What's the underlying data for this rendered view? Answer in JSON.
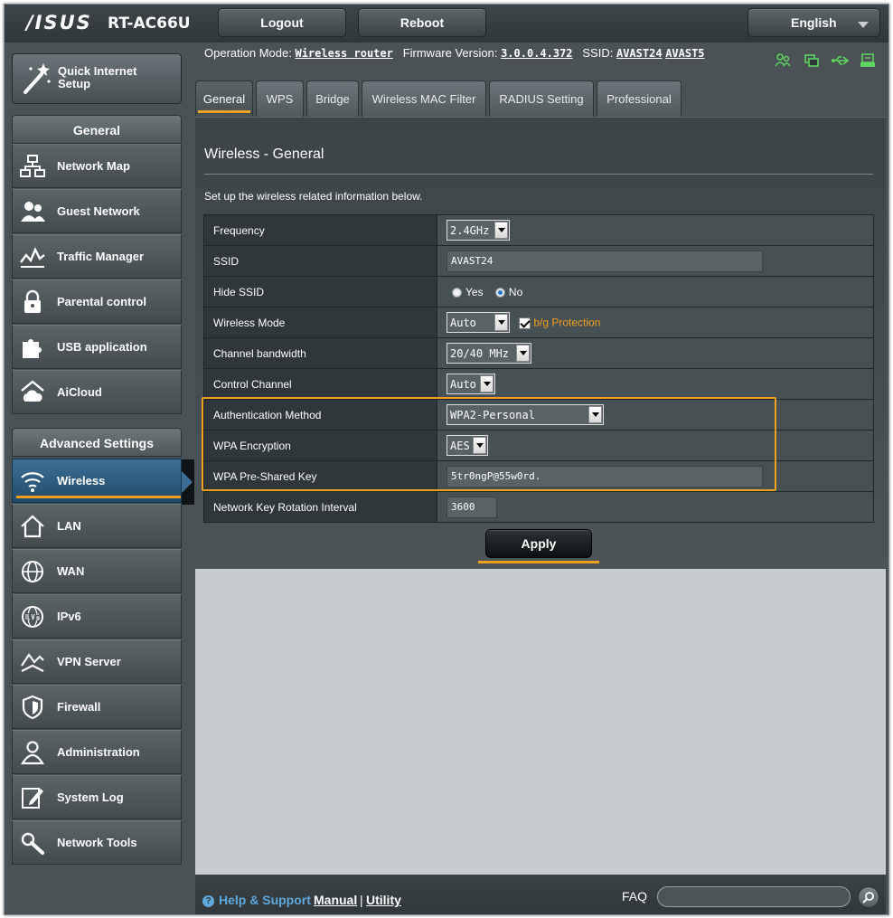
{
  "header": {
    "brand": "/ISUS",
    "model": "RT-AC66U",
    "logout_label": "Logout",
    "reboot_label": "Reboot",
    "language": "English"
  },
  "status": {
    "op_mode_label": "Operation Mode:",
    "op_mode_value": "Wireless router",
    "firmware_label": "Firmware Version:",
    "firmware_value": "3.0.0.4.372",
    "ssid_label": "SSID:",
    "ssid_1": "AVAST24",
    "ssid_2": "AVAST5"
  },
  "sidebar": {
    "quick_setup_line1": "Quick Internet",
    "quick_setup_line2": "Setup",
    "general_header": "General",
    "general_items": [
      {
        "label": "Network Map"
      },
      {
        "label": "Guest Network"
      },
      {
        "label": "Traffic Manager"
      },
      {
        "label": "Parental control"
      },
      {
        "label": "USB application"
      },
      {
        "label": "AiCloud"
      }
    ],
    "advanced_header": "Advanced Settings",
    "advanced_items": [
      {
        "label": "Wireless"
      },
      {
        "label": "LAN"
      },
      {
        "label": "WAN"
      },
      {
        "label": "IPv6"
      },
      {
        "label": "VPN Server"
      },
      {
        "label": "Firewall"
      },
      {
        "label": "Administration"
      },
      {
        "label": "System Log"
      },
      {
        "label": "Network Tools"
      }
    ]
  },
  "tabs": [
    {
      "label": "General"
    },
    {
      "label": "WPS"
    },
    {
      "label": "Bridge"
    },
    {
      "label": "Wireless MAC Filter"
    },
    {
      "label": "RADIUS Setting"
    },
    {
      "label": "Professional"
    }
  ],
  "main": {
    "title": "Wireless - General",
    "description": "Set up the wireless related information below.",
    "rows": [
      {
        "label": "Frequency",
        "value": "2.4GHz"
      },
      {
        "label": "SSID",
        "value": "AVAST24"
      },
      {
        "label": "Hide SSID",
        "yes": "Yes",
        "no": "No",
        "selected": "No"
      },
      {
        "label": "Wireless Mode",
        "value": "Auto",
        "checkbox_label": "b/g Protection"
      },
      {
        "label": "Channel bandwidth",
        "value": "20/40 MHz"
      },
      {
        "label": "Control Channel",
        "value": "Auto"
      },
      {
        "label": "Authentication Method",
        "value": "WPA2-Personal"
      },
      {
        "label": "WPA Encryption",
        "value": "AES"
      },
      {
        "label": "WPA Pre-Shared Key",
        "value": "5tr0ngP@55w0rd."
      },
      {
        "label": "Network Key Rotation Interval",
        "value": "3600"
      }
    ],
    "apply_label": "Apply"
  },
  "footer": {
    "help": "Help & Support",
    "manual": "Manual",
    "separator": "|",
    "utility": "Utility",
    "faq": "FAQ"
  },
  "colors": {
    "accent": "#f0a020",
    "active_item": "#2e5f86",
    "help_link": "#5fa7dd"
  }
}
